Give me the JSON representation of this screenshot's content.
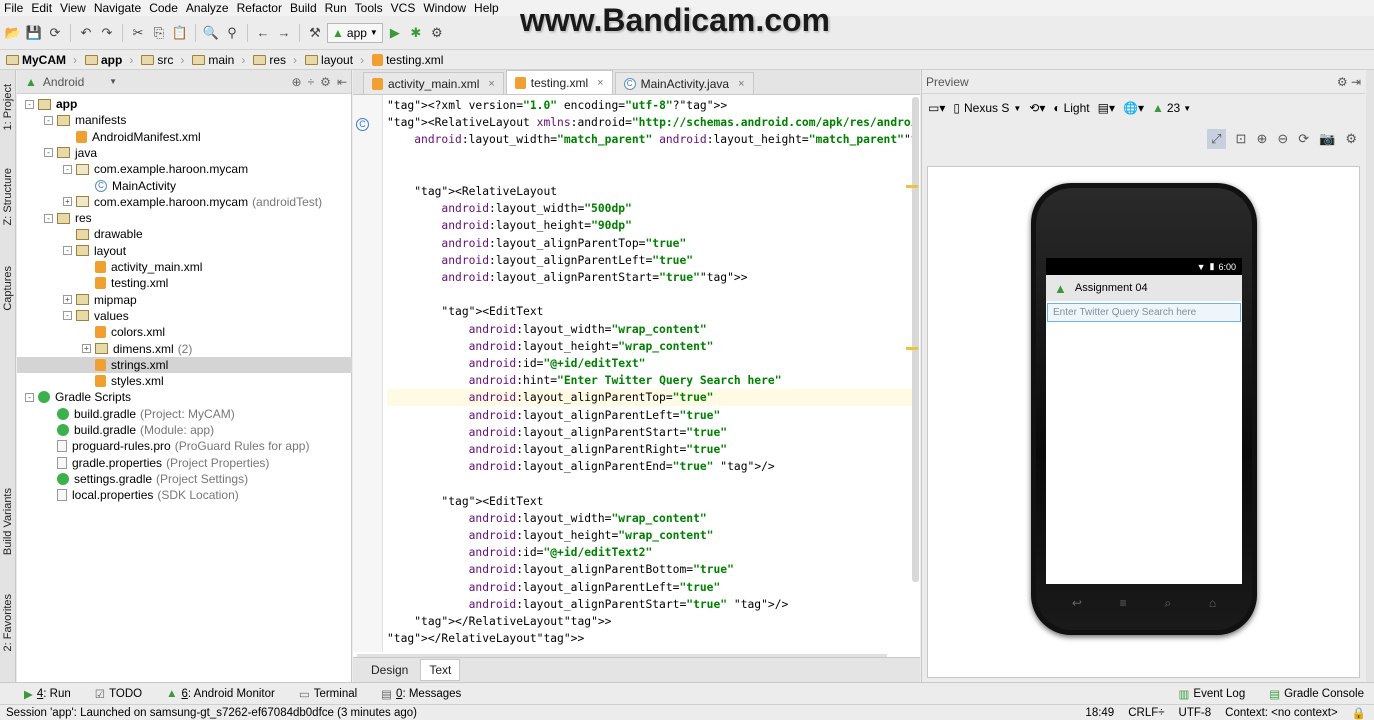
{
  "menu": [
    "File",
    "Edit",
    "View",
    "Navigate",
    "Code",
    "Analyze",
    "Refactor",
    "Build",
    "Run",
    "Tools",
    "VCS",
    "Window",
    "Help"
  ],
  "watermark": "www.Bandicam.com",
  "toolbar": {
    "run_config": "app"
  },
  "breadcrumbs": [
    "MyCAM",
    "app",
    "src",
    "main",
    "res",
    "layout",
    "testing.xml"
  ],
  "left_tools": [
    "1: Project",
    "Z: Structure",
    "Captures",
    "Build Variants",
    "2: Favorites"
  ],
  "project": {
    "view_select": "Android",
    "tree": [
      {
        "label": "app",
        "extra": "",
        "indent": 0,
        "icon": "fold",
        "exp": "-"
      },
      {
        "label": "manifests",
        "extra": "",
        "indent": 1,
        "icon": "fold",
        "exp": "-"
      },
      {
        "label": "AndroidManifest.xml",
        "extra": "",
        "indent": 2,
        "icon": "xml",
        "exp": ""
      },
      {
        "label": "java",
        "extra": "",
        "indent": 1,
        "icon": "fold",
        "exp": "-"
      },
      {
        "label": "com.example.haroon.mycam",
        "extra": "",
        "indent": 2,
        "icon": "pkg",
        "exp": "-"
      },
      {
        "label": "MainActivity",
        "extra": "",
        "indent": 3,
        "icon": "java",
        "exp": ""
      },
      {
        "label": "com.example.haroon.mycam",
        "extra": "(androidTest)",
        "indent": 2,
        "icon": "pkg",
        "exp": "+"
      },
      {
        "label": "res",
        "extra": "",
        "indent": 1,
        "icon": "fold",
        "exp": "-"
      },
      {
        "label": "drawable",
        "extra": "",
        "indent": 2,
        "icon": "fold",
        "exp": ""
      },
      {
        "label": "layout",
        "extra": "",
        "indent": 2,
        "icon": "fold",
        "exp": "-"
      },
      {
        "label": "activity_main.xml",
        "extra": "",
        "indent": 3,
        "icon": "xml",
        "exp": ""
      },
      {
        "label": "testing.xml",
        "extra": "",
        "indent": 3,
        "icon": "xml",
        "exp": ""
      },
      {
        "label": "mipmap",
        "extra": "",
        "indent": 2,
        "icon": "fold",
        "exp": "+"
      },
      {
        "label": "values",
        "extra": "",
        "indent": 2,
        "icon": "fold",
        "exp": "-"
      },
      {
        "label": "colors.xml",
        "extra": "",
        "indent": 3,
        "icon": "xml",
        "exp": ""
      },
      {
        "label": "dimens.xml",
        "extra": "(2)",
        "indent": 3,
        "icon": "fold",
        "exp": "+"
      },
      {
        "label": "strings.xml",
        "extra": "",
        "indent": 3,
        "icon": "xml",
        "exp": "",
        "selected": true
      },
      {
        "label": "styles.xml",
        "extra": "",
        "indent": 3,
        "icon": "xml",
        "exp": ""
      },
      {
        "label": "Gradle Scripts",
        "extra": "",
        "indent": 0,
        "icon": "grad",
        "exp": "-"
      },
      {
        "label": "build.gradle",
        "extra": "(Project: MyCAM)",
        "indent": 1,
        "icon": "grad",
        "exp": ""
      },
      {
        "label": "build.gradle",
        "extra": "(Module: app)",
        "indent": 1,
        "icon": "grad",
        "exp": ""
      },
      {
        "label": "proguard-rules.pro",
        "extra": "(ProGuard Rules for app)",
        "indent": 1,
        "icon": "file",
        "exp": ""
      },
      {
        "label": "gradle.properties",
        "extra": "(Project Properties)",
        "indent": 1,
        "icon": "file",
        "exp": ""
      },
      {
        "label": "settings.gradle",
        "extra": "(Project Settings)",
        "indent": 1,
        "icon": "grad",
        "exp": ""
      },
      {
        "label": "local.properties",
        "extra": "(SDK Location)",
        "indent": 1,
        "icon": "file",
        "exp": ""
      }
    ]
  },
  "editor": {
    "tabs": [
      {
        "label": "activity_main.xml",
        "active": false,
        "icon": "xml"
      },
      {
        "label": "testing.xml",
        "active": true,
        "icon": "xml"
      },
      {
        "label": "MainActivity.java",
        "active": false,
        "icon": "java"
      }
    ],
    "lines": [
      "<?xml version=\"1.0\" encoding=\"utf-8\"?>",
      "<RelativeLayout xmlns:android=\"http://schemas.android.com/apk/res/android\"",
      "    android:layout_width=\"match_parent\" android:layout_height=\"match_parent\">",
      "",
      "",
      "    <RelativeLayout",
      "        android:layout_width=\"500dp\"",
      "        android:layout_height=\"90dp\"",
      "        android:layout_alignParentTop=\"true\"",
      "        android:layout_alignParentLeft=\"true\"",
      "        android:layout_alignParentStart=\"true\">",
      "",
      "        <EditText",
      "            android:layout_width=\"wrap_content\"",
      "            android:layout_height=\"wrap_content\"",
      "            android:id=\"@+id/editText\"",
      "            android:hint=\"Enter Twitter Query Search here\"",
      "            android:layout_alignParentTop=\"true\"",
      "            android:layout_alignParentLeft=\"true\"",
      "            android:layout_alignParentStart=\"true\"",
      "            android:layout_alignParentRight=\"true\"",
      "            android:layout_alignParentEnd=\"true\" />",
      "",
      "        <EditText",
      "            android:layout_width=\"wrap_content\"",
      "            android:layout_height=\"wrap_content\"",
      "            android:id=\"@+id/editText2\"",
      "            android:layout_alignParentBottom=\"true\"",
      "            android:layout_alignParentLeft=\"true\"",
      "            android:layout_alignParentStart=\"true\" />",
      "    </RelativeLayout>",
      "</RelativeLayout>"
    ],
    "current_line": 17,
    "bottom_tabs": [
      "Design",
      "Text"
    ],
    "active_bottom_tab": "Text"
  },
  "preview": {
    "title": "Preview",
    "device": "Nexus S",
    "theme": "Light",
    "api": "23",
    "phone": {
      "time": "6:00",
      "app_title": "Assignment 04",
      "hint": "Enter Twitter Query Search here"
    }
  },
  "bottom_tools": [
    {
      "num": "4",
      "label": ": Run"
    },
    {
      "num": "",
      "label": "TODO"
    },
    {
      "num": "6",
      "label": ": Android Monitor"
    },
    {
      "num": "",
      "label": "Terminal"
    },
    {
      "num": "0",
      "label": ": Messages"
    }
  ],
  "bottom_tools_right": [
    "Event Log",
    "Gradle Console"
  ],
  "status": {
    "message": "Session 'app': Launched on samsung-gt_s7262-ef67084db0dfce (3 minutes ago)",
    "position": "18:49",
    "line_sep": "CRLF÷",
    "encoding": "UTF-8",
    "context": "Context: <no context>"
  }
}
